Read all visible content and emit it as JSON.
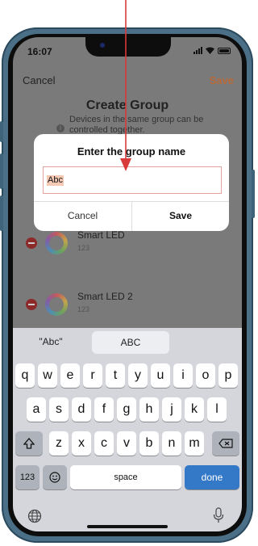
{
  "status": {
    "time": "16:07"
  },
  "nav": {
    "cancel": "Cancel",
    "save": "Save"
  },
  "page": {
    "title": "Create Group",
    "subtitle": "Devices in the same group can be controlled together."
  },
  "devices": [
    {
      "name": "Smart LED",
      "sub": "123"
    },
    {
      "name": "Smart LED 2",
      "sub": "123"
    }
  ],
  "dialog": {
    "title": "Enter the group name",
    "input_value": "Abc",
    "cancel": "Cancel",
    "save": "Save"
  },
  "keyboard": {
    "suggestions": [
      "\"Abc\"",
      "ABC"
    ],
    "row1": [
      "q",
      "w",
      "e",
      "r",
      "t",
      "y",
      "u",
      "i",
      "o",
      "p"
    ],
    "row2": [
      "a",
      "s",
      "d",
      "f",
      "g",
      "h",
      "j",
      "k",
      "l"
    ],
    "row3": [
      "z",
      "x",
      "c",
      "v",
      "b",
      "n",
      "m"
    ],
    "numbers": "123",
    "space": "space",
    "done": "done",
    "icons": {
      "shift": "shift-icon",
      "delete": "delete-icon",
      "emoji": "emoji-icon",
      "globe": "globe-icon",
      "mic": "microphone-icon"
    }
  },
  "colors": {
    "accent": "#b86a3a",
    "done": "#3478c8",
    "annotation": "#d93a3a"
  }
}
